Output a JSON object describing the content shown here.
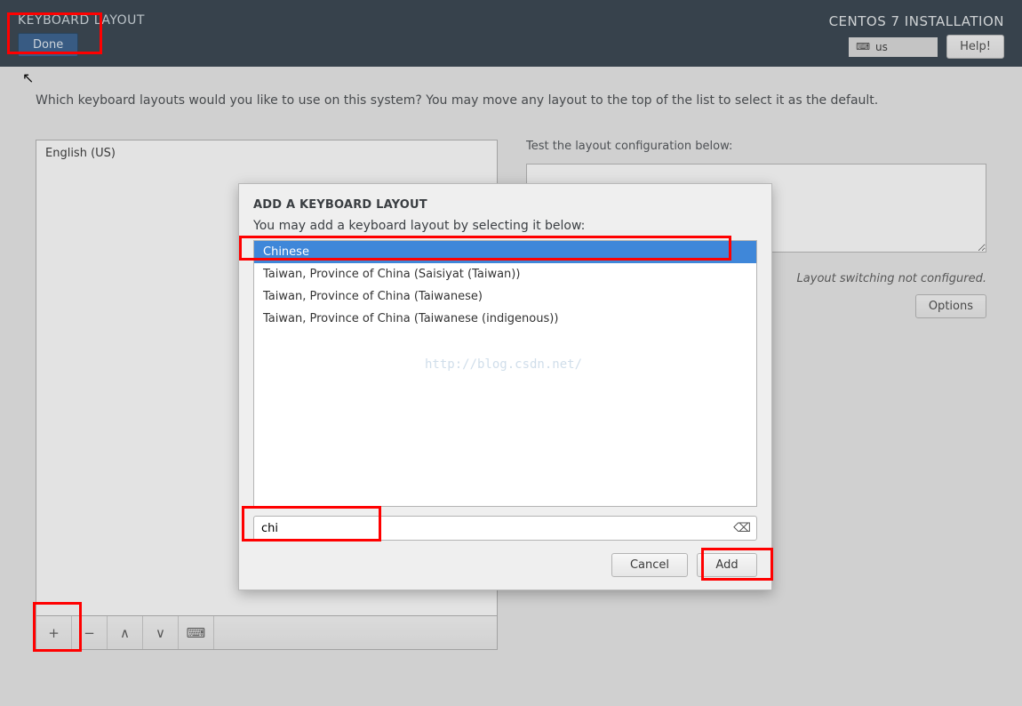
{
  "header": {
    "page_title": "KEYBOARD LAYOUT",
    "brand": "CENTOS 7 INSTALLATION",
    "done_label": "Done",
    "help_label": "Help!",
    "layout_indicator": "us"
  },
  "instructions": "Which keyboard layouts would you like to use on this system?  You may move any layout to the top of the list to select it as the default.",
  "layouts": {
    "items": [
      "English (US)"
    ]
  },
  "test": {
    "label": "Test the layout configuration below:",
    "switch_note": "Layout switching not configured.",
    "options_label": "Options"
  },
  "toolbar": {
    "add": "+",
    "remove": "−",
    "up": "∧",
    "down": "∨",
    "keyboard": "⌨"
  },
  "dialog": {
    "title": "ADD A KEYBOARD LAYOUT",
    "subtitle": "You may add a keyboard layout by selecting it below:",
    "items": [
      "Chinese",
      "Taiwan, Province of China (Saisiyat (Taiwan))",
      "Taiwan, Province of China (Taiwanese)",
      "Taiwan, Province of China (Taiwanese (indigenous))"
    ],
    "search_value": "chi",
    "cancel_label": "Cancel",
    "add_label": "Add"
  },
  "watermark": "http://blog.csdn.net/"
}
